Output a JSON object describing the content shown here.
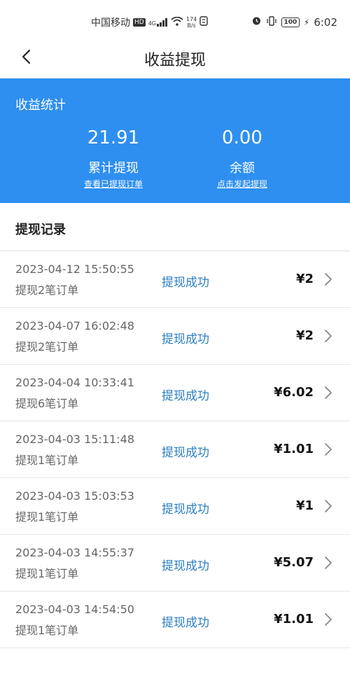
{
  "status_bar": {
    "carrier": "中国移动",
    "hd": "HD",
    "signal_type": "4G",
    "speed_value": "174",
    "speed_unit": "B/s",
    "battery": "100",
    "time": "6:02"
  },
  "nav": {
    "title": "收益提现",
    "back_icon": "chevron-left-icon"
  },
  "stats": {
    "title": "收益统计",
    "total_value": "21.91",
    "total_label": "累计提现",
    "total_link": "查看已提现订单",
    "balance_value": "0.00",
    "balance_label": "余额",
    "balance_link": "点击发起提现"
  },
  "records_title": "提现记录",
  "records": [
    {
      "date": "2023-04-12 15:50:55",
      "desc": "提现2笔订单",
      "status": "提现成功",
      "amount": "¥2"
    },
    {
      "date": "2023-04-07 16:02:48",
      "desc": "提现2笔订单",
      "status": "提现成功",
      "amount": "¥2"
    },
    {
      "date": "2023-04-04 10:33:41",
      "desc": "提现6笔订单",
      "status": "提现成功",
      "amount": "¥6.02"
    },
    {
      "date": "2023-04-03 15:11:48",
      "desc": "提现1笔订单",
      "status": "提现成功",
      "amount": "¥1.01"
    },
    {
      "date": "2023-04-03 15:03:53",
      "desc": "提现1笔订单",
      "status": "提现成功",
      "amount": "¥1"
    },
    {
      "date": "2023-04-03 14:55:37",
      "desc": "提现1笔订单",
      "status": "提现成功",
      "amount": "¥5.07"
    },
    {
      "date": "2023-04-03 14:54:50",
      "desc": "提现1笔订单",
      "status": "提现成功",
      "amount": "¥1.01"
    }
  ],
  "colors": {
    "accent": "#2e8ff0",
    "status_text": "#2d7fc2"
  }
}
